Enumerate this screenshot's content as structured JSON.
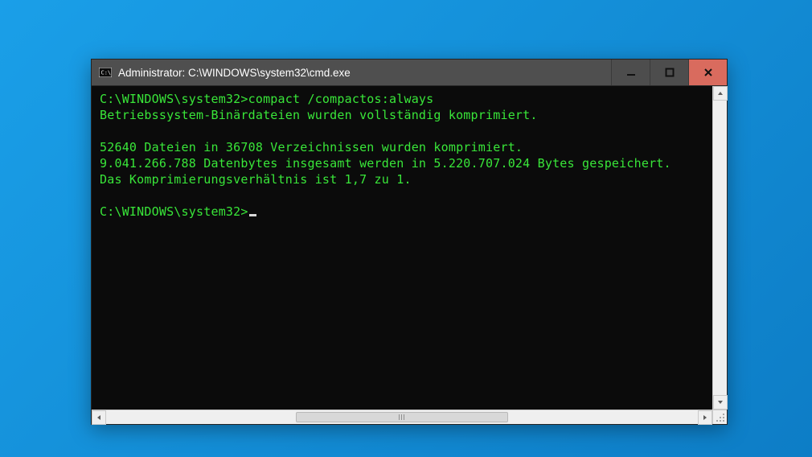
{
  "window": {
    "title": "Administrator: C:\\WINDOWS\\system32\\cmd.exe"
  },
  "terminal": {
    "lines": [
      "C:\\WINDOWS\\system32>compact /compactos:always",
      "Betriebssystem-Binärdateien wurden vollständig komprimiert.",
      "",
      "52640 Dateien in 36708 Verzeichnissen wurden komprimiert.",
      "9.041.266.788 Datenbytes insgesamt werden in 5.220.707.024 Bytes gespeichert.",
      "Das Komprimierungsverhältnis ist 1,7 zu 1.",
      "",
      "C:\\WINDOWS\\system32>"
    ],
    "prompt_has_cursor": true
  }
}
